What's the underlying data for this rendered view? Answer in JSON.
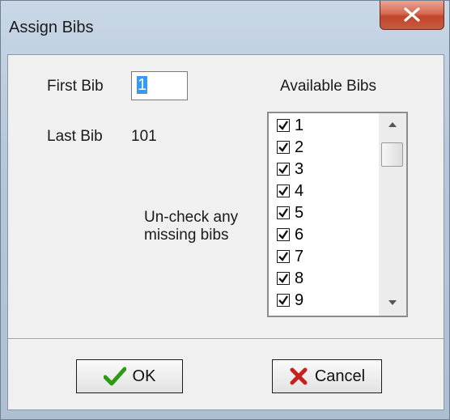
{
  "window": {
    "title": "Assign Bibs"
  },
  "form": {
    "first_bib_label": "First Bib",
    "first_bib_value": "1",
    "last_bib_label": "Last Bib",
    "last_bib_value": "101",
    "available_label": "Available Bibs",
    "hint_line1": "Un-check any",
    "hint_line2": "missing bibs"
  },
  "bib_list": {
    "items": [
      {
        "label": "1",
        "checked": true
      },
      {
        "label": "2",
        "checked": true
      },
      {
        "label": "3",
        "checked": true
      },
      {
        "label": "4",
        "checked": true
      },
      {
        "label": "5",
        "checked": true
      },
      {
        "label": "6",
        "checked": true
      },
      {
        "label": "7",
        "checked": true
      },
      {
        "label": "8",
        "checked": true
      },
      {
        "label": "9",
        "checked": true
      }
    ]
  },
  "buttons": {
    "ok_label": "OK",
    "cancel_label": "Cancel"
  },
  "colors": {
    "ok_check": "#2e9a12",
    "cancel_x": "#c8201b",
    "selection": "#3399ff"
  },
  "icons": {
    "close": "close-icon",
    "ok": "checkmark-icon",
    "cancel": "x-icon"
  }
}
